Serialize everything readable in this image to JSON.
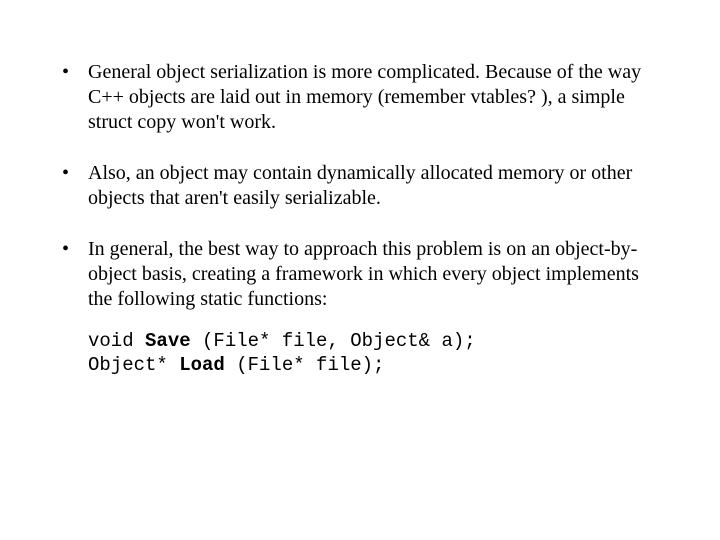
{
  "bullets": [
    "General object serialization is more complicated.  Because of the way C++ objects are laid out in memory (remember vtables? ), a simple struct copy won't work.",
    "Also, an object may contain dynamically allocated memory or other objects that aren't easily serializable.",
    "In general, the best way to approach this problem is on an object-by-object basis, creating a framework in which every object implements the following static functions:"
  ],
  "code": {
    "l1_pre": "void ",
    "l1_bold": "Save",
    "l1_post": " (File* file, Object& a);",
    "l2_pre": "Object* ",
    "l2_bold": "Load",
    "l2_post": " (File* file);"
  }
}
